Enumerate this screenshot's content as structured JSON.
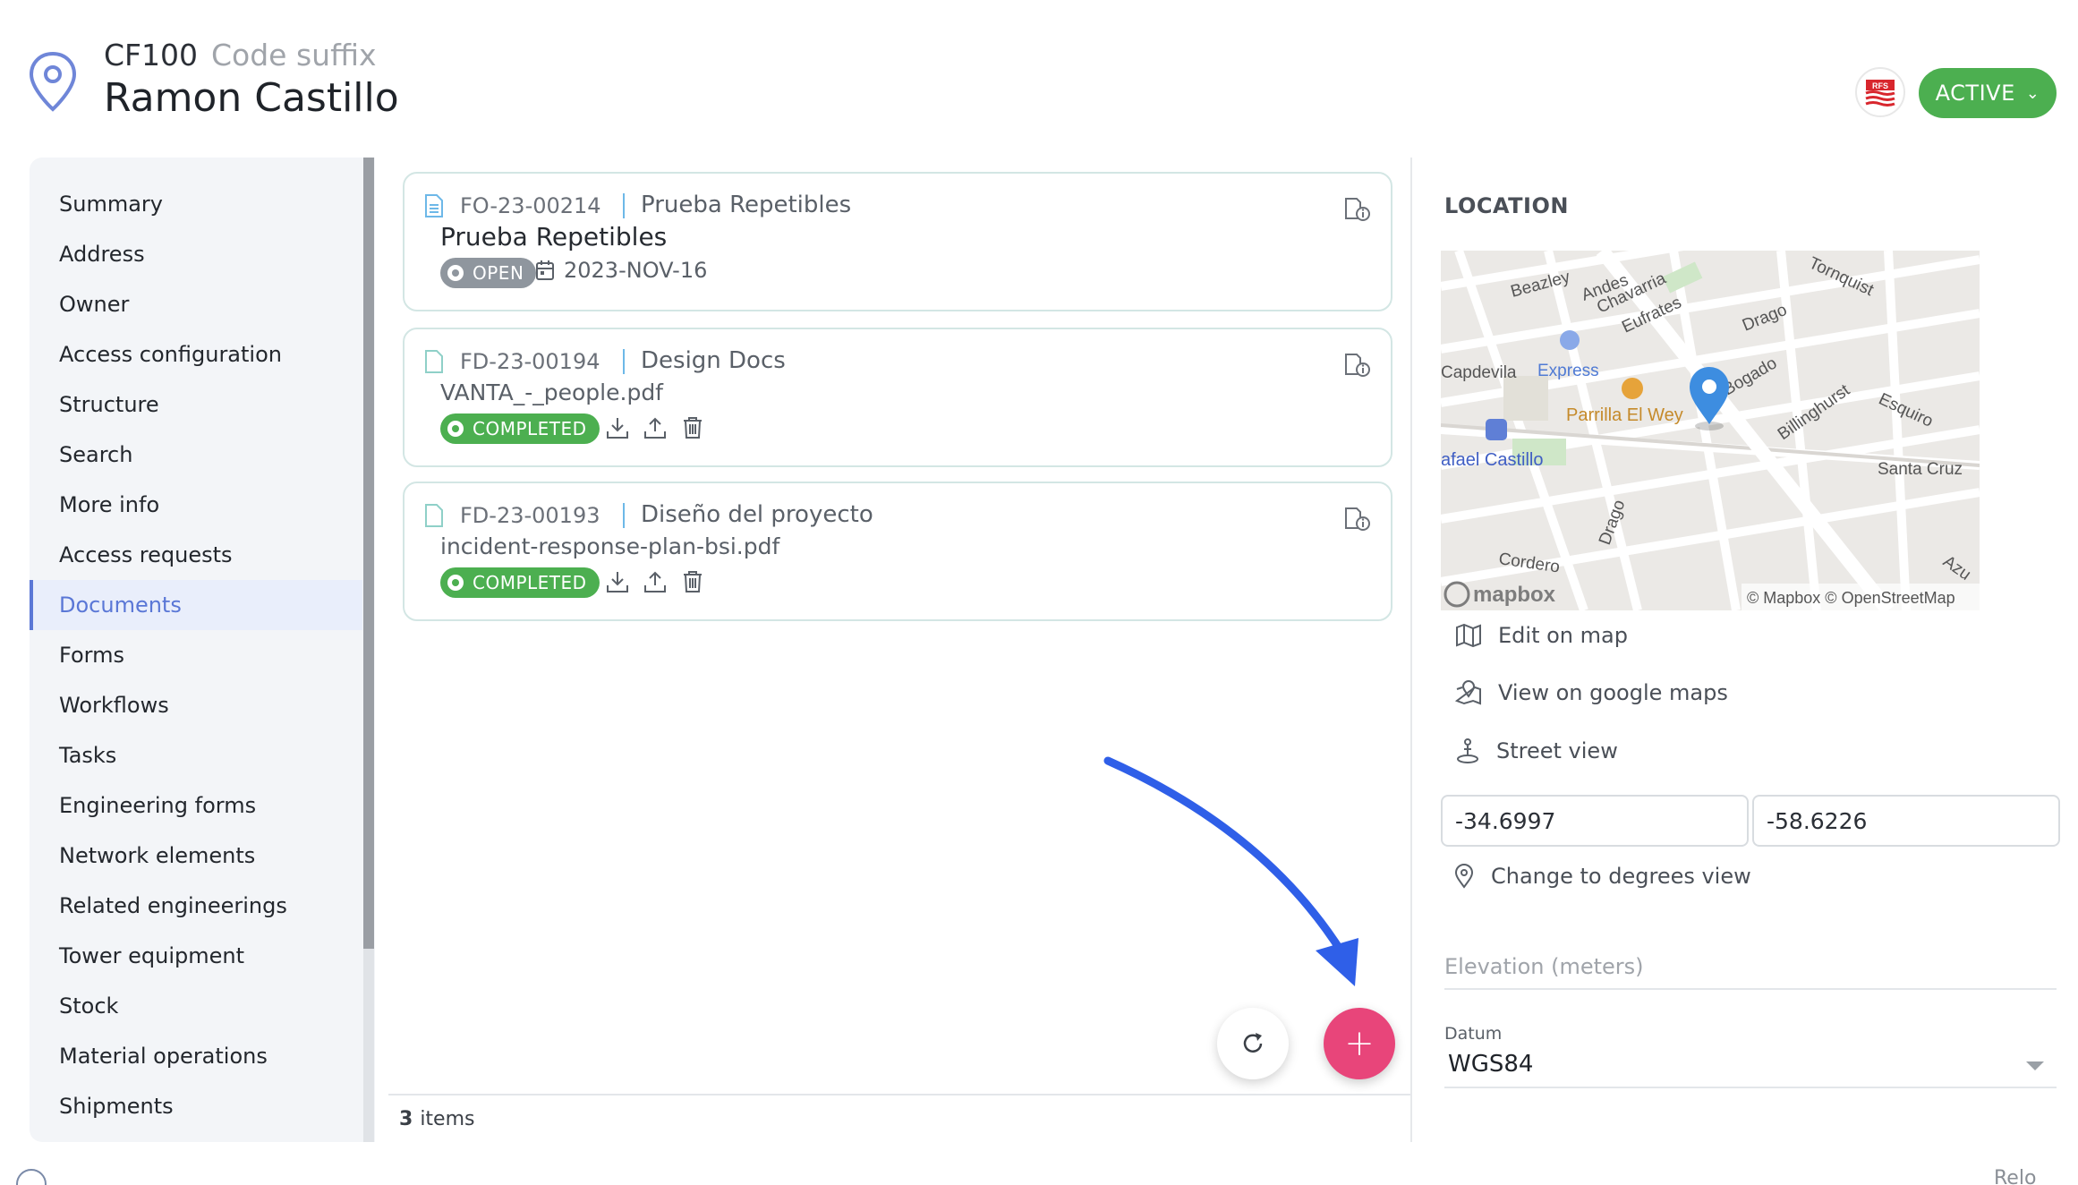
{
  "header": {
    "code": "CF100",
    "code_suffix": "Code suffix",
    "name": "Ramon Castillo",
    "logo_text": "RFS",
    "status": "ACTIVE"
  },
  "sidebar": {
    "items": [
      {
        "label": "Summary"
      },
      {
        "label": "Address"
      },
      {
        "label": "Owner"
      },
      {
        "label": "Access configuration"
      },
      {
        "label": "Structure"
      },
      {
        "label": "Search"
      },
      {
        "label": "More info"
      },
      {
        "label": "Access requests"
      },
      {
        "label": "Documents",
        "active": true
      },
      {
        "label": "Forms"
      },
      {
        "label": "Workflows"
      },
      {
        "label": "Tasks"
      },
      {
        "label": "Engineering forms"
      },
      {
        "label": "Network elements"
      },
      {
        "label": "Related engineerings"
      },
      {
        "label": "Tower equipment"
      },
      {
        "label": "Stock"
      },
      {
        "label": "Material operations"
      },
      {
        "label": "Shipments"
      }
    ]
  },
  "documents": [
    {
      "code": "FO-23-00214",
      "type": "Prueba Repetibles",
      "title": "Prueba Repetibles",
      "status": "OPEN",
      "date": "2023-NOV-16"
    },
    {
      "code": "FD-23-00194",
      "type": "Design Docs",
      "file": "VANTA_-_people.pdf",
      "status": "COMPLETED"
    },
    {
      "code": "FD-23-00193",
      "type": "Diseño del proyecto",
      "file": "incident-response-plan-bsi.pdf",
      "status": "COMPLETED"
    }
  ],
  "footer": {
    "count": "3",
    "count_label": "items"
  },
  "location": {
    "title": "LOCATION",
    "map_labels": {
      "beazley": "Beazley",
      "andes": "Andes",
      "chavarria": "Chavarria",
      "eufrates": "Eufrates",
      "tornquist": "Tornquist",
      "drago": "Drago",
      "capdevila": "Capdevila",
      "express": "Express",
      "bogado": "Bogado",
      "billinghurst": "Billinghurst",
      "esquiro": "Esquiro",
      "parrilla": "Parrilla El Wey",
      "rafael": "afael Castillo",
      "santa_cruz": "Santa Cruz",
      "drago2": "Drago",
      "cordero": "Cordero",
      "mapbox": "mapbox",
      "attribution": "© Mapbox © OpenStreetMap",
      "azu": "Azu"
    },
    "links": {
      "edit": "Edit on map",
      "google": "View on google maps",
      "street": "Street view",
      "degrees": "Change to degrees view"
    },
    "latitude": "-34.6997",
    "longitude": "-58.6226",
    "elevation_placeholder": "Elevation (meters)",
    "datum_label": "Datum",
    "datum_value": "WGS84"
  },
  "bottom_right": "Relo",
  "colors": {
    "accent": "#5a77d6",
    "active": "#4caf50",
    "fab": "#e8457a"
  }
}
